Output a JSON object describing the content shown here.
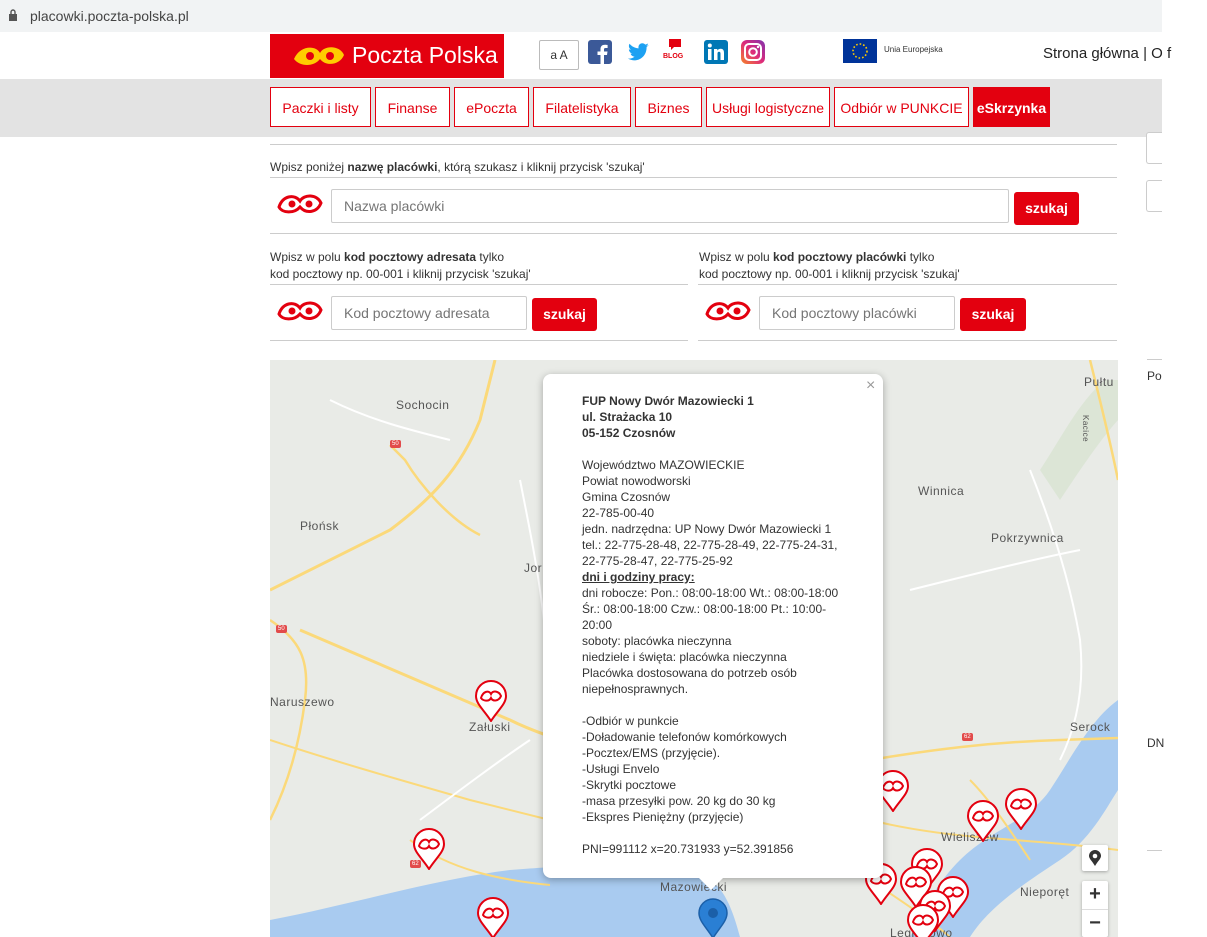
{
  "browser": {
    "url": "placowki.poczta-polska.pl"
  },
  "header": {
    "logo_text": "Poczta Polska",
    "font_size_button": "a A",
    "blog_label": "BLOG",
    "eu_label": "Unia Europejska",
    "top_links": "Strona główna | O f"
  },
  "nav": {
    "items": [
      {
        "label": "Paczki i listy"
      },
      {
        "label": "Finanse"
      },
      {
        "label": "ePoczta"
      },
      {
        "label": "Filatelistyka"
      },
      {
        "label": "Biznes"
      },
      {
        "label": "Usługi logistyczne"
      },
      {
        "label": "Odbiór w PUNKCIE"
      },
      {
        "label": "eSkrzynka"
      }
    ]
  },
  "search": {
    "name": {
      "hint_pre": "Wpisz poniżej ",
      "hint_bold": "nazwę placówki",
      "hint_post": ", którą szukasz i kliknij przycisk 'szukaj'",
      "placeholder": "Nazwa placówki",
      "button": "szukaj"
    },
    "addressee": {
      "hint_pre": "Wpisz w polu ",
      "hint_bold": "kod pocztowy adresata",
      "hint_post": " tylko",
      "hint_line2": "kod pocztowy np. 00-001 i kliknij przycisk 'szukaj'",
      "placeholder": "Kod pocztowy adresata",
      "button": "szukaj"
    },
    "office": {
      "hint_pre": "Wpisz w polu ",
      "hint_bold": "kod pocztowy placówki",
      "hint_post": " tylko",
      "hint_line2": "kod pocztowy np. 00-001 i kliknij przycisk 'szukaj'",
      "placeholder": "Kod pocztowy placówki",
      "button": "szukaj"
    }
  },
  "sidebar": {
    "label_1": "Po",
    "label_2": "DN"
  },
  "map": {
    "places": {
      "sochocin": "Sochocin",
      "plonsk": "Płońsk",
      "naruszewo": "Naruszewo",
      "zaluski": "Załuski",
      "winnica": "Winnica",
      "pokrzywnica": "Pokrzywnica",
      "serock": "Serock",
      "wieliszew": "Wieliszew",
      "nieporet": "Nieporęt",
      "pultusk": "Pułtu",
      "kacice": "Kacice",
      "jo": "Jor",
      "mazowiecki": "Mazowiecki",
      "legionowo": "Legionowo"
    },
    "roads": {
      "r1": "50",
      "r2": "50",
      "r3": "62",
      "r4": "62"
    },
    "zoom_in": "+",
    "zoom_out": "−",
    "popup": {
      "close": "×",
      "name": "FUP Nowy Dwór Mazowiecki 1",
      "street": "ul. Strażacka 10",
      "city": "05-152 Czosnów",
      "voivodeship": "Województwo MAZOWIECKIE",
      "county": "Powiat nowodworski",
      "commune": "Gmina Czosnów",
      "code": "22-785-00-40",
      "parent": "jedn. nadrzędna: UP Nowy Dwór Mazowiecki 1",
      "tel1": "tel.: 22-775-28-48, 22-775-28-49, 22-775-24-31,",
      "tel2": "22-775-28-47, 22-775-25-92",
      "hours_title": "dni i godziny pracy:",
      "hours1": "dni robocze: Pon.: 08:00-18:00 Wt.: 08:00-18:00",
      "hours2": "Śr.: 08:00-18:00 Czw.: 08:00-18:00 Pt.: 10:00-",
      "hours3": "20:00",
      "saturday": "soboty: placówka nieczynna",
      "sunday": "niedziele i święta: placówka nieczynna",
      "access1": "Placówka dostosowana do potrzeb osób",
      "access2": "niepełnosprawnych.",
      "services": [
        "-Odbiór w punkcie",
        "-Doładowanie telefonów komórkowych",
        "-Pocztex/EMS (przyjęcie).",
        "-Usługi Envelo",
        "-Skrytki pocztowe",
        "-masa przesyłki pow. 20 kg do 30 kg",
        "-Ekspres Pieniężny (przyjęcie)"
      ],
      "pni": "PNI=991112 x=20.731933 y=52.391856"
    }
  },
  "colors": {
    "brand_red": "#e3000f",
    "nav_band": "#e3e3e3",
    "water": "#a9cbf0",
    "road": "#fbd97a"
  }
}
